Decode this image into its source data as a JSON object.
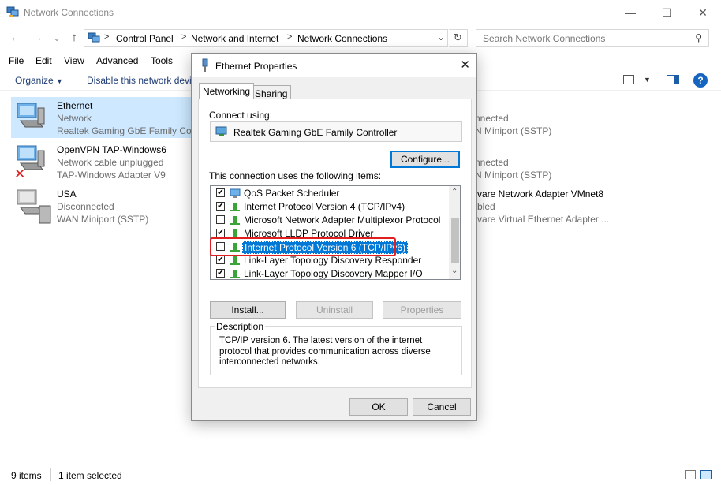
{
  "window": {
    "title": "Network Connections",
    "controls": [
      "—",
      "☐",
      "✕"
    ]
  },
  "nav": {
    "back": "←",
    "forward": "→",
    "recent": "⌄",
    "up": "↑",
    "breadcrumb": [
      "Control Panel",
      "Network and Internet",
      "Network Connections"
    ],
    "search_placeholder": "Search Network Connections"
  },
  "menu": [
    "File",
    "Edit",
    "View",
    "Advanced",
    "Tools"
  ],
  "toolbar": {
    "organize": "Organize",
    "disable": "Disable this network devi"
  },
  "connections": [
    {
      "name": "Ethernet",
      "status": "Network",
      "adapter": "Realtek Gaming GbE Family Con",
      "selected": true
    },
    {
      "name": "OpenVPN TAP-Windows6",
      "status": "Network cable unplugged",
      "adapter": "TAP-Windows Adapter V9",
      "error": true
    },
    {
      "name": "USA",
      "status": "Disconnected",
      "adapter": "WAN Miniport (SSTP)"
    }
  ],
  "right_column": [
    {
      "status": "nnected",
      "adapter": "N Miniport (SSTP)"
    },
    {
      "status": "nnected",
      "adapter": "N Miniport (SSTP)"
    },
    {
      "name": "vare Network Adapter VMnet8",
      "status": "bled",
      "adapter": "vare Virtual Ethernet Adapter ..."
    }
  ],
  "status_bar": {
    "count": "9 items",
    "selected": "1 item selected"
  },
  "dialog": {
    "title": "Ethernet Properties",
    "tabs": [
      "Networking",
      "Sharing"
    ],
    "connect_using_label": "Connect using:",
    "adapter_name": "Realtek Gaming GbE Family Controller",
    "configure_button": "Configure...",
    "items_label": "This connection uses the following items:",
    "items": [
      {
        "label": "QoS Packet Scheduler",
        "checked": true
      },
      {
        "label": "Internet Protocol Version 4 (TCP/IPv4)",
        "checked": true
      },
      {
        "label": "Microsoft Network Adapter Multiplexor Protocol",
        "checked": false
      },
      {
        "label": "Microsoft LLDP Protocol Driver",
        "checked": true
      },
      {
        "label": "Internet Protocol Version 6 (TCP/IPv6)",
        "checked": false,
        "selected": true
      },
      {
        "label": "Link-Layer Topology Discovery Responder",
        "checked": true
      },
      {
        "label": "Link-Layer Topology Discovery Mapper I/O Driver",
        "checked": true
      }
    ],
    "install_button": "Install...",
    "uninstall_button": "Uninstall",
    "properties_button": "Properties",
    "description_legend": "Description",
    "description_text": "TCP/IP version 6. The latest version of the internet protocol that provides communication across diverse interconnected networks.",
    "ok_button": "OK",
    "cancel_button": "Cancel"
  },
  "colors": {
    "accent": "#0078d7",
    "selection": "#cde8ff",
    "highlight_box": "#e02020",
    "list_selection": "#0078d7"
  }
}
